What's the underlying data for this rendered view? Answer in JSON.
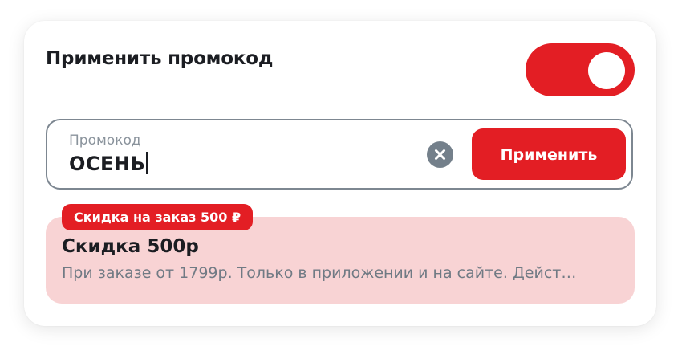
{
  "promo": {
    "title": "Применить промокод",
    "toggle_on": true,
    "field_label": "Промокод",
    "field_value": "ОСЕНЬ",
    "apply_label": "Применить"
  },
  "offer": {
    "badge": "Скидка на заказ 500 ₽",
    "title": "Скидка 500р",
    "description": "При заказе от 1799р. Только в приложении и на сайте. Дейст…"
  },
  "colors": {
    "accent": "#e31e24",
    "offer_bg": "#f8d3d4",
    "text": "#1b1d22",
    "muted": "#707a84"
  },
  "icons": {
    "clear": "close-icon"
  }
}
